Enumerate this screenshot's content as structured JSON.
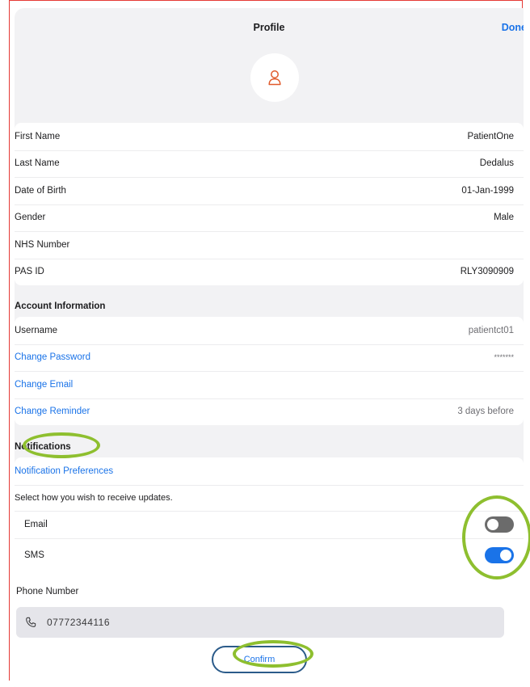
{
  "header": {
    "title": "Profile",
    "done_label": "Done"
  },
  "avatar": {
    "icon": "person-icon",
    "color": "#e05a2b"
  },
  "personal": [
    {
      "label": "First Name",
      "value": "PatientOne"
    },
    {
      "label": "Last Name",
      "value": "Dedalus"
    },
    {
      "label": "Date of Birth",
      "value": "01-Jan-1999"
    },
    {
      "label": "Gender",
      "value": "Male"
    },
    {
      "label": "NHS Number",
      "value": ""
    },
    {
      "label": "PAS ID",
      "value": "RLY3090909"
    }
  ],
  "account": {
    "heading": "Account Information",
    "username_label": "Username",
    "username_value": "patientct01",
    "change_password_label": "Change Password",
    "password_mask": "*******",
    "change_email_label": "Change Email",
    "change_reminder_label": "Change Reminder",
    "reminder_value": "3 days before"
  },
  "notifications": {
    "heading": "Notifications",
    "preferences_label": "Notification Preferences",
    "hint": "Select how you wish to receive updates.",
    "email_label": "Email",
    "email_enabled": false,
    "sms_label": "SMS",
    "sms_enabled": true,
    "phone_label": "Phone Number",
    "phone_value": "07772344116",
    "phone_icon": "phone-icon",
    "confirm_label": "Confirm"
  },
  "colors": {
    "accent": "#1a73e8",
    "highlight_ring": "#8ebf2f",
    "frame": "#e53935"
  }
}
